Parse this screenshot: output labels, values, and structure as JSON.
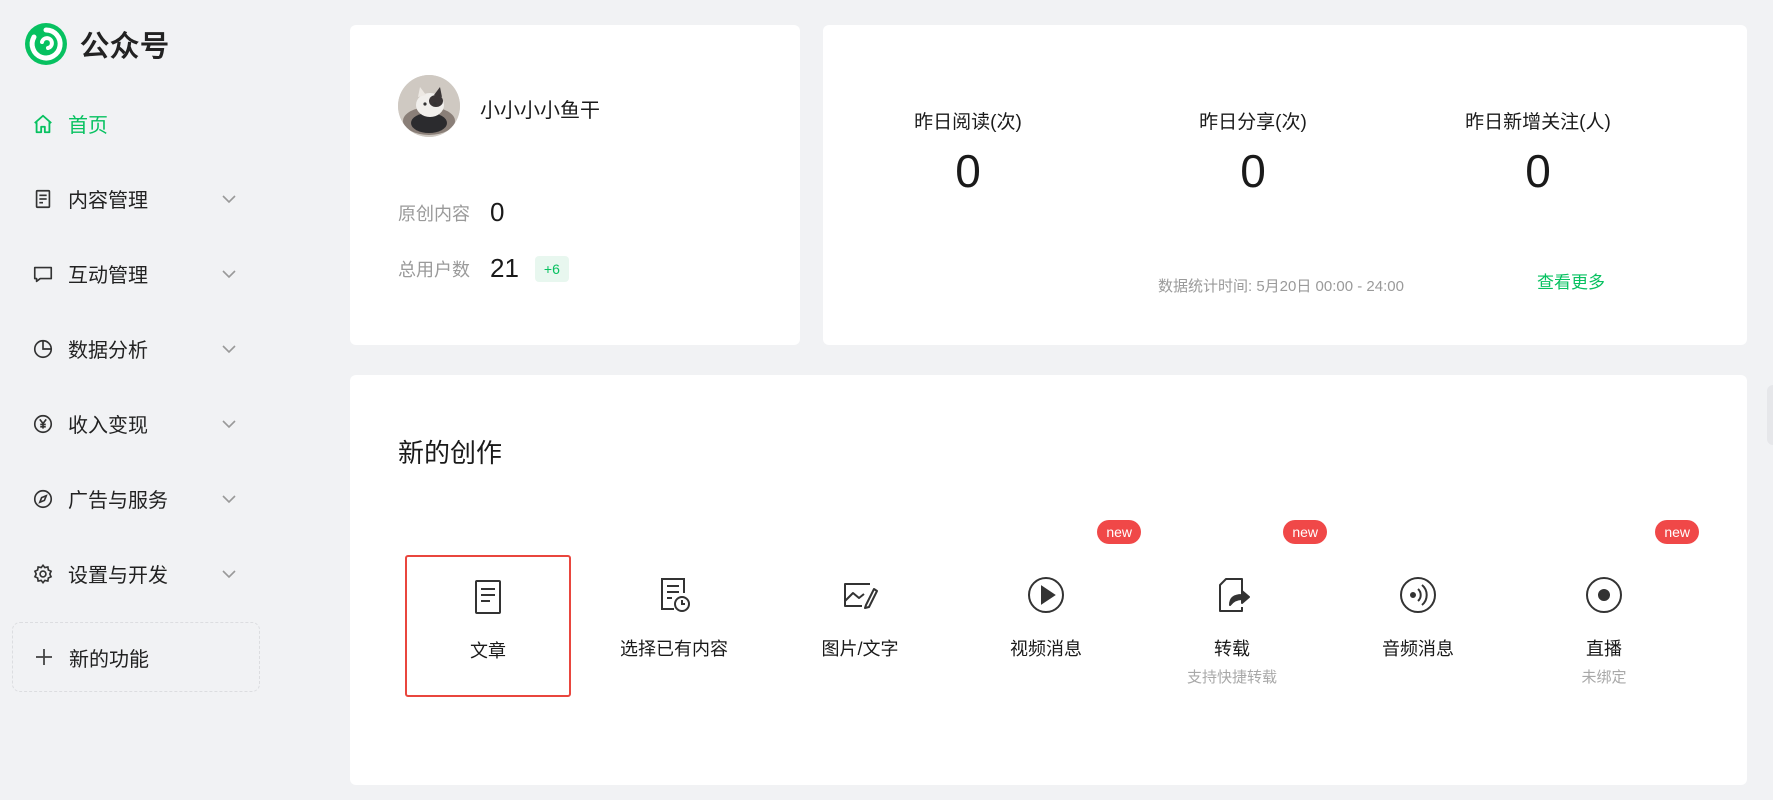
{
  "app": {
    "name": "公众号",
    "brand_color": "#07c160"
  },
  "sidebar": {
    "items": [
      {
        "label": "首页",
        "icon": "home-icon",
        "active": true,
        "expandable": false
      },
      {
        "label": "内容管理",
        "icon": "document-icon",
        "active": false,
        "expandable": true
      },
      {
        "label": "互动管理",
        "icon": "chat-icon",
        "active": false,
        "expandable": true
      },
      {
        "label": "数据分析",
        "icon": "pie-chart-icon",
        "active": false,
        "expandable": true
      },
      {
        "label": "收入变现",
        "icon": "yen-icon",
        "active": false,
        "expandable": true
      },
      {
        "label": "广告与服务",
        "icon": "compass-icon",
        "active": false,
        "expandable": true
      },
      {
        "label": "设置与开发",
        "icon": "gear-icon",
        "active": false,
        "expandable": true
      }
    ],
    "new_feature_label": "新的功能"
  },
  "profile": {
    "name": "小小小小鱼干",
    "original_label": "原创内容",
    "original_value": "0",
    "users_label": "总用户数",
    "users_value": "21",
    "users_delta": "+6"
  },
  "stats": {
    "read_label": "昨日阅读(次)",
    "read_value": "0",
    "share_label": "昨日分享(次)",
    "share_value": "0",
    "follow_label": "昨日新增关注(人)",
    "follow_value": "0",
    "time_text": "数据统计时间: 5月20日 00:00 - 24:00",
    "more_label": "查看更多"
  },
  "create": {
    "title": "新的创作",
    "tools": [
      {
        "label": "文章",
        "icon": "article-icon",
        "sub": "",
        "badge": "",
        "selected": true
      },
      {
        "label": "选择已有内容",
        "icon": "existing-content-icon",
        "sub": "",
        "badge": "",
        "selected": false
      },
      {
        "label": "图片/文字",
        "icon": "image-text-icon",
        "sub": "",
        "badge": "",
        "selected": false
      },
      {
        "label": "视频消息",
        "icon": "play-icon",
        "sub": "",
        "badge": "new",
        "selected": false
      },
      {
        "label": "转载",
        "icon": "repost-icon",
        "sub": "支持快捷转载",
        "badge": "new",
        "selected": false
      },
      {
        "label": "音频消息",
        "icon": "audio-icon",
        "sub": "",
        "badge": "",
        "selected": false
      },
      {
        "label": "直播",
        "icon": "live-icon",
        "sub": "未绑定",
        "badge": "new",
        "selected": false
      }
    ]
  }
}
